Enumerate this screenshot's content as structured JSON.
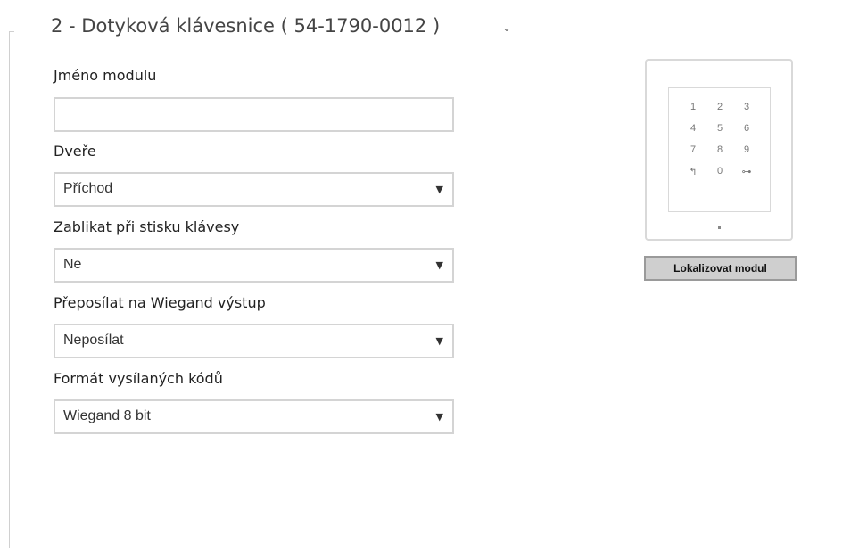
{
  "section": {
    "title": "2 - Dotyková klávesnice ( 54-1790-0012 )",
    "chevron": "⌄"
  },
  "fields": {
    "module_name": {
      "label": "Jméno modulu",
      "value": ""
    },
    "door": {
      "label": "Dveře",
      "value": "Příchod"
    },
    "blink": {
      "label": "Zablikat při stisku klávesy",
      "value": "Ne"
    },
    "wiegand_forward": {
      "label": "Přeposílat na Wiegand výstup",
      "value": "Neposílat"
    },
    "code_format": {
      "label": "Formát vysílaných kódů",
      "value": "Wiegand 8 bit"
    }
  },
  "device": {
    "keys": [
      "1",
      "2",
      "3",
      "4",
      "5",
      "6",
      "7",
      "8",
      "9",
      "↰",
      "0",
      "⊶"
    ]
  },
  "buttons": {
    "locate": "Lokalizovat modul"
  }
}
